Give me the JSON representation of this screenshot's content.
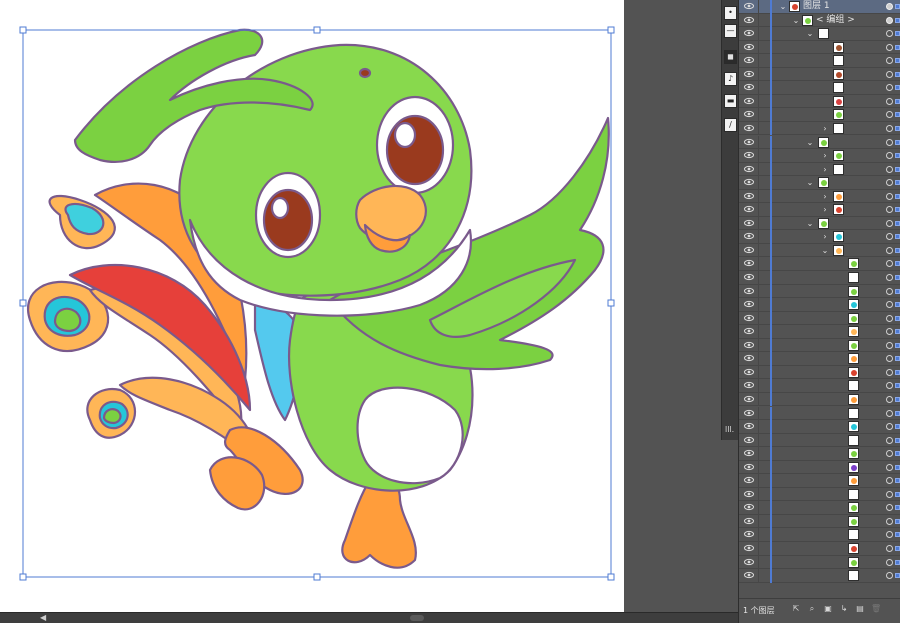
{
  "layers_panel": {
    "top_layer_name": "图层 1",
    "group_name": "< 编组 >",
    "footer_label": "1 个图层"
  },
  "thumb_colors": [
    "#d9432f",
    "#7bd141",
    "#ffffff",
    "#a0522d",
    "#ffffff",
    "#b24a2a",
    "#ffffff",
    "#d94242",
    "#7bd141",
    "#ffffff",
    "#7bd141",
    "#7bd141",
    "#ffffff",
    "#7bd141",
    "#ff9d3b",
    "#d9432f",
    "#7bd141",
    "#25c6d9",
    "#ffb657",
    "#7bd141",
    "#ffffff",
    "#7bd141",
    "#25c6d9",
    "#7bd141",
    "#ffb657",
    "#7bd141",
    "#ff9d3b",
    "#d9432f",
    "#ffffff",
    "#ff9d3b",
    "#ffffff",
    "#25c6d9",
    "#ffffff",
    "#7bd141",
    "#7b3ec9",
    "#ff9d3b",
    "#ffffff",
    "#7bd141",
    "#7bd141",
    "#ffffff"
  ],
  "accent_color": "#4f7bd3"
}
